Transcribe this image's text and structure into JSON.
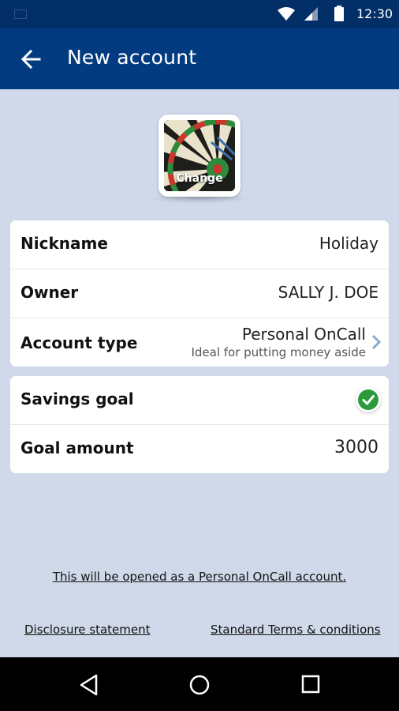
{
  "status_bar": {
    "time": "12:30"
  },
  "app_bar": {
    "title": "New account",
    "back_icon": "arrow-left-icon"
  },
  "avatar": {
    "change_label": "Change",
    "image": "dartboard-image"
  },
  "account_details": {
    "nickname": {
      "label": "Nickname",
      "value": "Holiday"
    },
    "owner": {
      "label": "Owner",
      "value": "SALLY J. DOE"
    },
    "account_type": {
      "label": "Account type",
      "value": "Personal OnCall",
      "description": "Ideal for putting money aside"
    }
  },
  "savings": {
    "goal": {
      "label": "Savings goal",
      "checked": true
    },
    "amount": {
      "label": "Goal amount",
      "value": "3000"
    }
  },
  "info_link": "This will be opened as a Personal OnCall account.",
  "footer": {
    "disclosure": "Disclosure statement",
    "terms": "Standard Terms & conditions"
  },
  "colors": {
    "status_bar": "#022f68",
    "app_bar": "#023b80",
    "background": "#cfd9e9",
    "check_green": "#2a9a3a",
    "chevron": "#8da7d0"
  }
}
